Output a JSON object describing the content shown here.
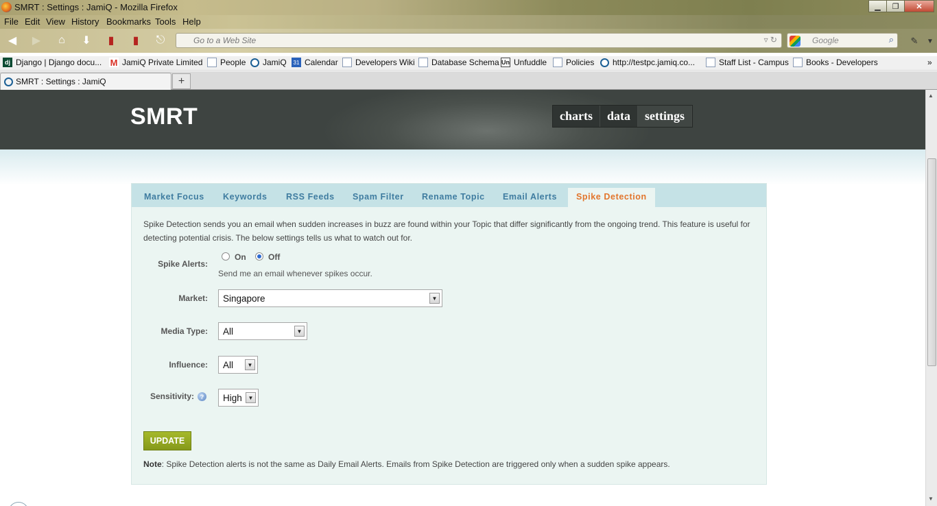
{
  "window": {
    "title": "SMRT : Settings : JamiQ - Mozilla Firefox",
    "buttons": {
      "minimize": "▁",
      "maximize": "❐",
      "close": "✕"
    }
  },
  "menubar": [
    "File",
    "Edit",
    "View",
    "History",
    "Bookmarks",
    "Tools",
    "Help"
  ],
  "toolbar": {
    "url_placeholder": "Go to a Web Site",
    "search_placeholder": "Google"
  },
  "bookmarks": [
    {
      "label": "Django | Django docu...",
      "icon": "django-icon",
      "glyph": "dj"
    },
    {
      "label": "JamiQ Private Limited",
      "icon": "gmail-icon",
      "glyph": "M"
    },
    {
      "label": "People",
      "icon": "page-icon",
      "glyph": ""
    },
    {
      "label": "JamiQ",
      "icon": "jamiq-icon",
      "glyph": ""
    },
    {
      "label": "Calendar",
      "icon": "calendar-icon",
      "glyph": "31"
    },
    {
      "label": "Developers Wiki",
      "icon": "page-icon",
      "glyph": ""
    },
    {
      "label": "Database Schema",
      "icon": "page-icon",
      "glyph": ""
    },
    {
      "label": "Unfuddle",
      "icon": "unfuddle-icon",
      "glyph": "Un"
    },
    {
      "label": "Policies",
      "icon": "page-icon",
      "glyph": ""
    },
    {
      "label": "http://testpc.jamiq.co...",
      "icon": "jamiq-icon",
      "glyph": ""
    },
    {
      "label": "Staff List - Campus",
      "icon": "page-icon",
      "glyph": ""
    },
    {
      "label": "Books - Developers",
      "icon": "page-icon",
      "glyph": ""
    }
  ],
  "tab": {
    "title": "SMRT : Settings : JamiQ",
    "new_tab": "+"
  },
  "site": {
    "logo": "SMRT",
    "nav": [
      "charts",
      "data",
      "settings"
    ],
    "active_nav": "settings"
  },
  "settings_tabs": [
    "Market Focus",
    "Keywords",
    "RSS Feeds",
    "Spam Filter",
    "Rename Topic",
    "Email Alerts",
    "Spike Detection"
  ],
  "active_settings_tab": "Spike Detection",
  "form": {
    "description": "Spike Detection sends you an email when sudden increases in buzz are found within your Topic that differ significantly from the ongoing trend. This feature is useful for detecting potential crisis. The below settings tells us what to watch out for.",
    "spike_alerts_label": "Spike Alerts:",
    "on_label": "On",
    "off_label": "Off",
    "spike_alerts_value": "Off",
    "spike_hint": "Send me an email whenever spikes occur.",
    "market_label": "Market:",
    "market_value": "Singapore",
    "media_type_label": "Media Type:",
    "media_type_value": "All",
    "influence_label": "Influence:",
    "influence_value": "All",
    "sensitivity_label": "Sensitivity:",
    "sensitivity_value": "High",
    "update_label": "UPDATE",
    "note_bold": "Note",
    "note_text": ": Spike Detection alerts is not the same as Daily Email Alerts. Emails from Spike Detection are triggered only when a sudden spike appears."
  }
}
